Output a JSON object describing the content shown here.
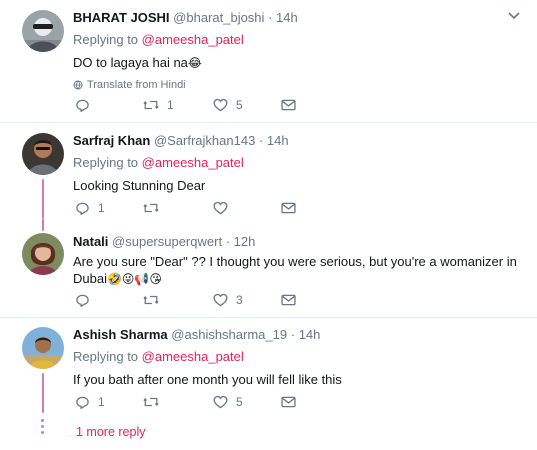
{
  "tweets": [
    {
      "name": "BHARAT JOSHI",
      "handle": "@bharat_bjoshi",
      "time": "14h",
      "replying_prefix": "Replying to",
      "replying_to": "@ameesha_patel",
      "text": "DO to lagaya hai na",
      "emoji": "😂",
      "translate": "Translate from Hindi",
      "counts": {
        "reply": "",
        "retweet": "1",
        "like": "5"
      }
    },
    {
      "name": "Sarfraj Khan",
      "handle": "@Sarfrajkhan143",
      "time": "14h",
      "replying_prefix": "Replying to",
      "replying_to": "@ameesha_patel",
      "text": "Looking Stunning Dear",
      "counts": {
        "reply": "1",
        "retweet": "",
        "like": ""
      }
    },
    {
      "name": "Natali",
      "handle": "@supersuperqwert",
      "time": "12h",
      "text_line1": "Are you sure \"Dear\" ?? I thought you were serious, but you're a womanizer in",
      "text_line2": "Dubai",
      "emoji": "🤣😜📢😘",
      "counts": {
        "reply": "",
        "retweet": "",
        "like": "3"
      }
    },
    {
      "name": "Ashish Sharma",
      "handle": "@ashishsharma_19",
      "time": "14h",
      "replying_prefix": "Replying to",
      "replying_to": "@ameesha_patel",
      "text": "If you bath after one month you will fell like this",
      "counts": {
        "reply": "1",
        "retweet": "",
        "like": "5"
      }
    }
  ],
  "more_reply": "1 more reply",
  "colors": {
    "accent": "#e0245e",
    "thread": "#cf7bb6",
    "muted": "#657786",
    "border": "#e6ecf0"
  }
}
